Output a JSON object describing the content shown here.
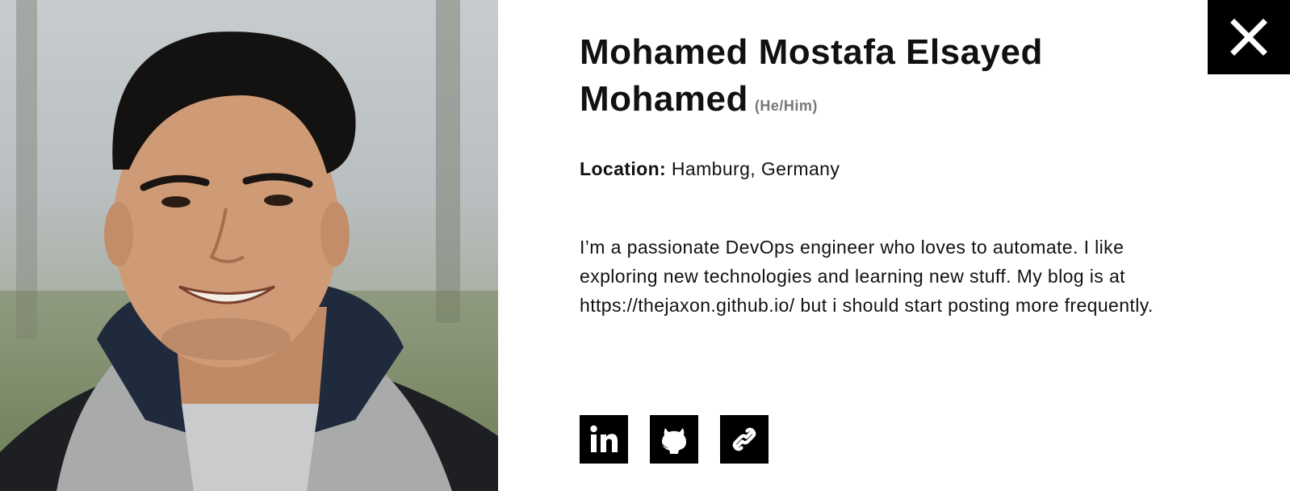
{
  "profile": {
    "name": "Mohamed Mostafa Elsayed Mohamed",
    "pronouns": "(He/Him)",
    "location_label": "Location:",
    "location_value": "Hamburg, Germany",
    "bio": "I’m a passionate DevOps engineer who loves to automate. I like exploring new technologies and learning new stuff. My blog is at https://thejaxon.github.io/ but i should start posting more frequently."
  },
  "social_links": [
    {
      "icon": "linkedin-icon"
    },
    {
      "icon": "github-icon"
    },
    {
      "icon": "link-icon"
    }
  ],
  "close_button": {
    "icon": "close-icon"
  },
  "colors": {
    "accent": "#000000",
    "text": "#111111",
    "muted": "#777777",
    "background": "#ffffff"
  }
}
